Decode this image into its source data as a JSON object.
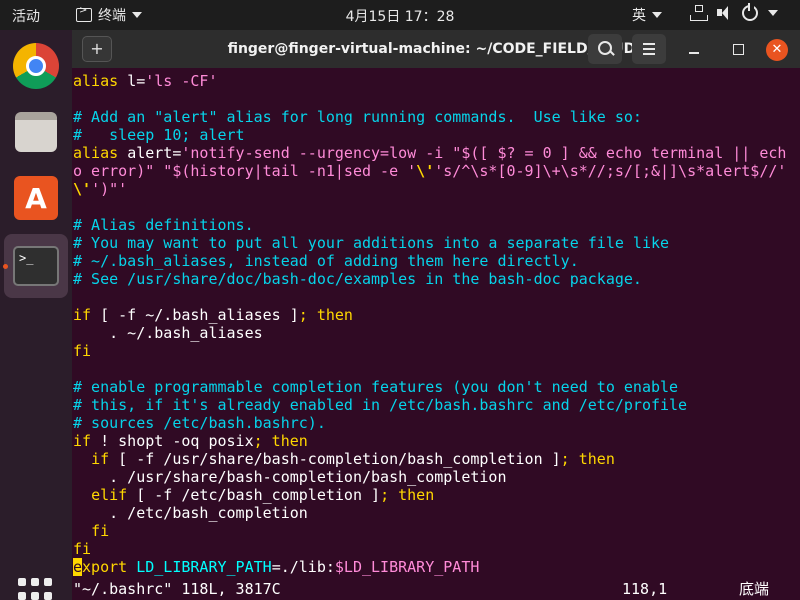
{
  "topbar": {
    "activities": "活动",
    "app_name": "终端",
    "clock": "4月15日  17：28",
    "input_method": "英"
  },
  "dock": {
    "items": [
      "chrome-browser",
      "files",
      "ubuntu-software",
      "terminal",
      "show-applications"
    ]
  },
  "window": {
    "title": "finger@finger-virtual-machine: ~/CODE_FIELD/STUDY",
    "new_tab": "+"
  },
  "editor": {
    "lines": [
      {
        "kind": "alias",
        "parts": [
          [
            "al",
            "alias "
          ],
          [
            "t",
            "l="
          ],
          [
            "st",
            "'ls -CF'"
          ]
        ]
      },
      {
        "kind": "blank",
        "parts": []
      },
      {
        "kind": "comment",
        "parts": [
          [
            "cm",
            "# Add an \"alert\" alias for long running commands.  Use like so:"
          ]
        ]
      },
      {
        "kind": "comment",
        "parts": [
          [
            "cm",
            "#   sleep 10; alert"
          ]
        ]
      },
      {
        "kind": "alias",
        "parts": [
          [
            "al",
            "alias "
          ],
          [
            "t",
            "alert="
          ],
          [
            "st",
            "'notify-send --urgency=low -i \"$([ $? = 0 ] && echo terminal || ech"
          ]
        ]
      },
      {
        "kind": "wrap",
        "parts": [
          [
            "st",
            "o error)\" \"$(history|tail -n1|sed -e '"
          ],
          [
            "yb",
            "\\'"
          ],
          [
            "st",
            "'s/^\\s*[0-9]\\+\\s*//;s/[;&|]\\s*alert$//'"
          ]
        ]
      },
      {
        "kind": "wrap",
        "parts": [
          [
            "yb",
            "\\'"
          ],
          [
            "st",
            "')\"'"
          ]
        ]
      },
      {
        "kind": "blank",
        "parts": []
      },
      {
        "kind": "comment",
        "parts": [
          [
            "cm",
            "# Alias definitions."
          ]
        ]
      },
      {
        "kind": "comment",
        "parts": [
          [
            "cm",
            "# You may want to put all your additions into a separate file like"
          ]
        ]
      },
      {
        "kind": "comment",
        "parts": [
          [
            "cm",
            "# ~/.bash_aliases, instead of adding them here directly."
          ]
        ]
      },
      {
        "kind": "comment",
        "parts": [
          [
            "cm",
            "# See /usr/share/doc/bash-doc/examples in the bash-doc package."
          ]
        ]
      },
      {
        "kind": "blank",
        "parts": []
      },
      {
        "kind": "code",
        "parts": [
          [
            "kw",
            "if"
          ],
          [
            "t",
            " [ -f ~/.bash_aliases ]"
          ],
          [
            "kw",
            "; then"
          ]
        ]
      },
      {
        "kind": "code",
        "parts": [
          [
            "t",
            "    . ~/.bash_aliases"
          ]
        ]
      },
      {
        "kind": "code",
        "parts": [
          [
            "kw",
            "fi"
          ]
        ]
      },
      {
        "kind": "blank",
        "parts": []
      },
      {
        "kind": "comment",
        "parts": [
          [
            "cm",
            "# enable programmable completion features (you don't need to enable"
          ]
        ]
      },
      {
        "kind": "comment",
        "parts": [
          [
            "cm",
            "# this, if it's already enabled in /etc/bash.bashrc and /etc/profile"
          ]
        ]
      },
      {
        "kind": "comment",
        "parts": [
          [
            "cm",
            "# sources /etc/bash.bashrc)."
          ]
        ]
      },
      {
        "kind": "code",
        "parts": [
          [
            "kw",
            "if"
          ],
          [
            "t",
            " ! shopt -oq posix"
          ],
          [
            "kw",
            "; then"
          ]
        ]
      },
      {
        "kind": "code",
        "parts": [
          [
            "t",
            "  "
          ],
          [
            "kw",
            "if"
          ],
          [
            "t",
            " [ -f /usr/share/bash-completion/bash_completion ]"
          ],
          [
            "kw",
            "; then"
          ]
        ]
      },
      {
        "kind": "code",
        "parts": [
          [
            "t",
            "    . /usr/share/bash-completion/bash_completion"
          ]
        ]
      },
      {
        "kind": "code",
        "parts": [
          [
            "t",
            "  "
          ],
          [
            "kw",
            "elif"
          ],
          [
            "t",
            " [ -f /etc/bash_completion ]"
          ],
          [
            "kw",
            "; then"
          ]
        ]
      },
      {
        "kind": "code",
        "parts": [
          [
            "t",
            "    . /etc/bash_completion"
          ]
        ]
      },
      {
        "kind": "code",
        "parts": [
          [
            "t",
            "  "
          ],
          [
            "kw",
            "fi"
          ]
        ]
      },
      {
        "kind": "code",
        "parts": [
          [
            "kw",
            "fi"
          ]
        ]
      },
      {
        "kind": "code",
        "parts": [
          [
            "cur",
            "e"
          ],
          [
            "kw",
            "xport "
          ],
          [
            "bl",
            "LD_LIBRARY_PATH"
          ],
          [
            "t",
            "=./lib:"
          ],
          [
            "vr",
            "$LD_LIBRARY_PATH"
          ]
        ]
      }
    ]
  },
  "statusline": {
    "file_info": "\"~/.bashrc\" 118L, 3817C",
    "cursor_pos": "118,1",
    "scroll_pos": "底端"
  },
  "colors": {
    "terminal_bg": "#300a24",
    "comment": "#06d4ea",
    "keyword": "#ffd700",
    "string": "#ff8bd8",
    "accent": "#e95420"
  }
}
